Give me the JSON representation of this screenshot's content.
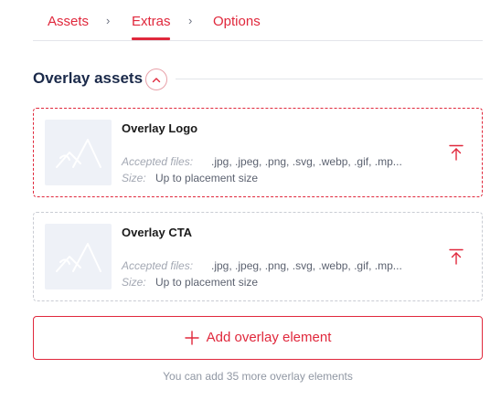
{
  "breadcrumb": {
    "tabs": [
      {
        "label": "Assets"
      },
      {
        "label": "Extras"
      },
      {
        "label": "Options"
      }
    ],
    "active_tab": "Extras",
    "separator": "›"
  },
  "section": {
    "title": "Overlay assets",
    "collapse_icon": "chevron-up-icon"
  },
  "assets": [
    {
      "title": "Overlay Logo",
      "accepted_label": "Accepted files:",
      "accepted_value": ".jpg, .jpeg, .png, .svg, .webp, .gif, .mp...",
      "size_label": "Size:",
      "size_value": "Up to placement size",
      "border_state": "error",
      "thumbnail_icon": "image-placeholder-icon",
      "upload_icon": "upload-icon"
    },
    {
      "title": "Overlay CTA",
      "accepted_label": "Accepted files:",
      "accepted_value": ".jpg, .jpeg, .png, .svg, .webp, .gif, .mp...",
      "size_label": "Size:",
      "size_value": "Up to placement size",
      "border_state": "default",
      "thumbnail_icon": "image-placeholder-icon",
      "upload_icon": "upload-icon"
    }
  ],
  "add_button": {
    "label": "Add overlay element",
    "icon": "plus-icon"
  },
  "hint": "You can add 35 more overlay elements",
  "colors": {
    "accent": "#e0283c",
    "heading": "#1b2a4a",
    "muted": "#9097a3",
    "placeholder_bg": "#eef1f7"
  }
}
